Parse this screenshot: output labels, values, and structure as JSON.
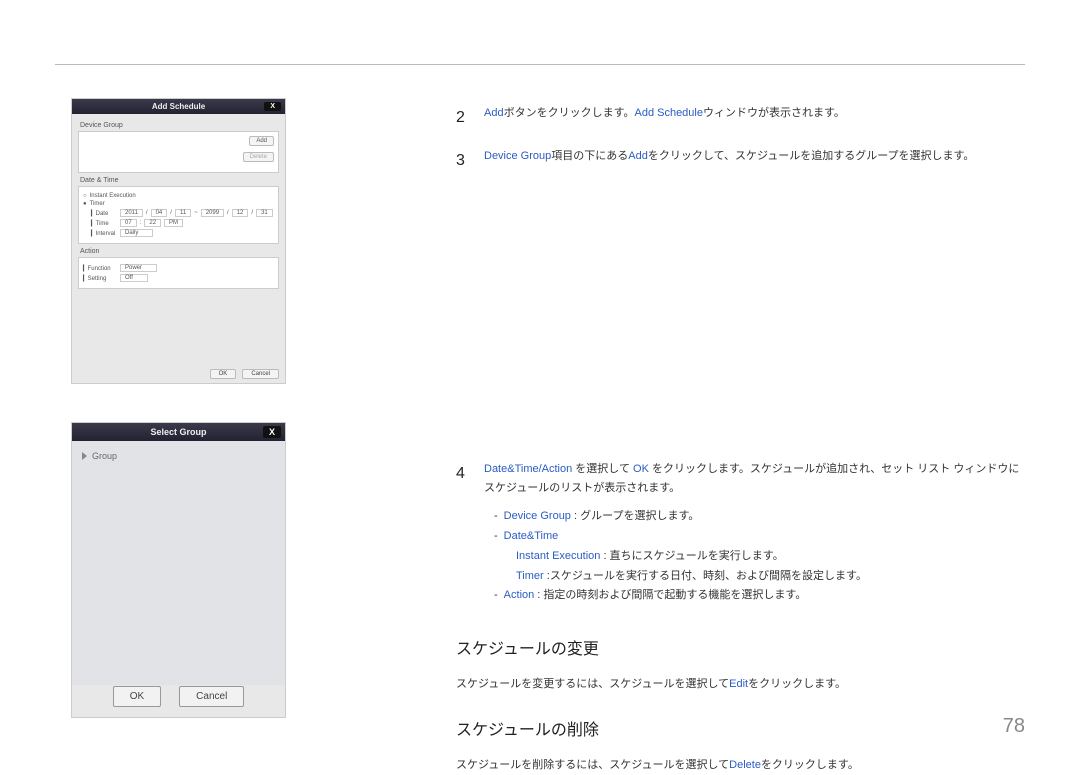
{
  "page_number": "78",
  "fig1": {
    "title": "Add Schedule",
    "close": "X",
    "device_group_label": "Device Group",
    "add_btn": "Add",
    "delete_btn": "Delete",
    "datetime_label": "Date & Time",
    "instant_label": "Instant Execution",
    "timer_label": "Timer",
    "date_label": "Date",
    "date_v1": "2011",
    "date_v2": "04",
    "date_v3": "11",
    "date_v4": "2099",
    "date_v5": "12",
    "date_v6": "31",
    "time_label": "Time",
    "time_h": "07",
    "time_m": "22",
    "time_ampm": "PM",
    "interval_label": "Interval",
    "interval_v": "Daily",
    "action_label": "Action",
    "function_label": "Function",
    "function_v": "Power",
    "setting_label": "Setting",
    "setting_v": "Off",
    "ok": "OK",
    "cancel": "Cancel"
  },
  "fig2": {
    "title": "Select Group",
    "close": "X",
    "group_item": "Group",
    "ok": "OK",
    "cancel": "Cancel"
  },
  "steps": {
    "s2": {
      "num": "2",
      "p_add": "Add",
      "p_mid": "ボタンをクリックします。",
      "p_addsched": "Add Schedule",
      "p_tail": "ウィンドウが表示されます。"
    },
    "s3": {
      "num": "3",
      "p_devgroup": "Device Group",
      "p_mid1": "項目の下にある",
      "p_addem": "Add",
      "p_mid2": "をクリックして、スケジュールを追加するグループを選択します。"
    },
    "s4": {
      "num": "4",
      "p_dtaction": "Date&Time/Action",
      "p_mid1": " を選択して ",
      "p_ok": "OK",
      "p_mid2": " をクリックします。スケジュールが追加され、セット リスト ウィンドウにスケジュールのリストが表示されます。",
      "b1_em": "Device Group",
      "b1_txt": " : グループを選択します。",
      "b2_em": "Date&Time",
      "b2a_em": "Instant Execution",
      "b2a_txt": " : 直ちにスケジュールを実行します。",
      "b2b_em": "Timer",
      "b2b_txt": " :スケジュールを実行する日付、時刻、および間隔を設定します。",
      "b3_em": "Action",
      "b3_txt": " : 指定の時刻および間隔で起動する機能を選択します。"
    }
  },
  "sec_edit": {
    "title": "スケジュールの変更",
    "p1_a": "スケジュールを変更するには、スケジュールを選択して",
    "p1_em": "Edit",
    "p1_b": "をクリックします。"
  },
  "sec_delete": {
    "title": "スケジュールの削除",
    "p1_a": "スケジュールを削除するには、スケジュールを選択して",
    "p1_em": "Delete",
    "p1_b": "をクリックします。"
  }
}
